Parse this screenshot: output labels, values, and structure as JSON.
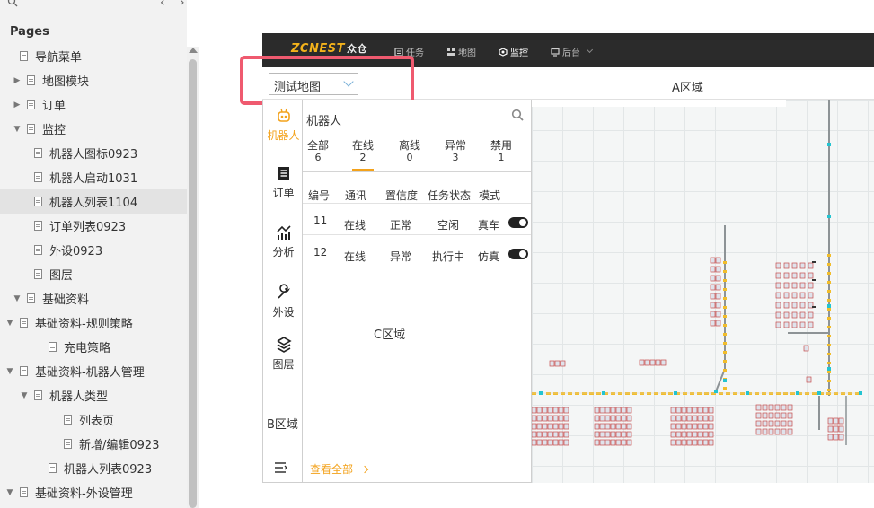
{
  "pages_panel": {
    "title": "Pages",
    "nav_prev": "‹",
    "nav_next": "›",
    "items": [
      {
        "label": "导航菜单",
        "level": 1,
        "expand": "",
        "selected": false
      },
      {
        "label": "地图模块",
        "level": 0,
        "expand": "▶",
        "selected": false
      },
      {
        "label": "订单",
        "level": 0,
        "expand": "▶",
        "selected": false
      },
      {
        "label": "监控",
        "level": 0,
        "expand": "▼",
        "selected": false
      },
      {
        "label": "机器人图标0923",
        "level": 2,
        "expand": "",
        "selected": false
      },
      {
        "label": "机器人启动1031",
        "level": 2,
        "expand": "",
        "selected": false
      },
      {
        "label": "机器人列表1104",
        "level": 2,
        "expand": "",
        "selected": true
      },
      {
        "label": "订单列表0923",
        "level": 2,
        "expand": "",
        "selected": false
      },
      {
        "label": "外设0923",
        "level": 2,
        "expand": "",
        "selected": false
      },
      {
        "label": "图层",
        "level": 2,
        "expand": "",
        "selected": false
      },
      {
        "label": "基础资料",
        "level": 0,
        "expand": "▼",
        "selected": false
      },
      {
        "label": "基础资料-规则策略",
        "level": 1,
        "expand": "▼",
        "selected": false
      },
      {
        "label": "充电策略",
        "level": 3,
        "expand": "",
        "selected": false
      },
      {
        "label": "基础资料-机器人管理",
        "level": 1,
        "expand": "▼",
        "selected": false
      },
      {
        "label": "机器人类型",
        "level": 2,
        "expand": "▼",
        "selected": false
      },
      {
        "label": "列表页",
        "level": 4,
        "expand": "",
        "selected": false
      },
      {
        "label": "新增/编辑0923",
        "level": 4,
        "expand": "",
        "selected": false
      },
      {
        "label": "机器人列表0923",
        "level": 3,
        "expand": "",
        "selected": false
      },
      {
        "label": "基础资料-外设管理",
        "level": 1,
        "expand": "▼",
        "selected": false
      }
    ]
  },
  "header": {
    "logo": "ZCNEST",
    "logo_cn": "众仓",
    "nav": [
      {
        "label": "任务",
        "icon": "task-icon"
      },
      {
        "label": "地图",
        "icon": "map-icon"
      },
      {
        "label": "监控",
        "icon": "monitor-icon",
        "active": true
      },
      {
        "label": "后台",
        "icon": "backend-icon"
      }
    ]
  },
  "toolbar": {
    "map_select_value": "测试地图",
    "area_a_label": "A区域"
  },
  "sidebar_b": {
    "items": [
      {
        "label": "机器人",
        "icon": "robot-icon",
        "active": true
      },
      {
        "label": "订单",
        "icon": "order-icon"
      },
      {
        "label": "分析",
        "icon": "analysis-icon"
      },
      {
        "label": "外设",
        "icon": "wrench-icon"
      },
      {
        "label": "图层",
        "icon": "layers-icon"
      }
    ],
    "area_label": "B区域",
    "menu_icon": "menu-icon"
  },
  "robot_panel": {
    "title": "机器人",
    "tabs": [
      {
        "label": "全部",
        "count": "6"
      },
      {
        "label": "在线",
        "count": "2",
        "active": true
      },
      {
        "label": "离线",
        "count": "0"
      },
      {
        "label": "异常",
        "count": "3"
      },
      {
        "label": "禁用",
        "count": "1"
      }
    ],
    "columns": [
      "编号",
      "通讯",
      "置信度",
      "任务状态",
      "模式"
    ],
    "rows": [
      {
        "id": "11",
        "comm": "在线",
        "confidence": "正常",
        "task": "空闲",
        "mode": "真车",
        "toggle": true
      },
      {
        "id": "12",
        "comm": "在线",
        "confidence": "异常",
        "task": "执行中",
        "mode": "仿真",
        "toggle": true
      }
    ],
    "area_label": "C区域",
    "view_all": "查看全部"
  },
  "colors": {
    "accent": "#f3a21b",
    "header_bg": "#2b2b2b",
    "highlight": "#ef5a6f",
    "map_path": "#f2bd2a",
    "map_node": "#23c4d1"
  }
}
